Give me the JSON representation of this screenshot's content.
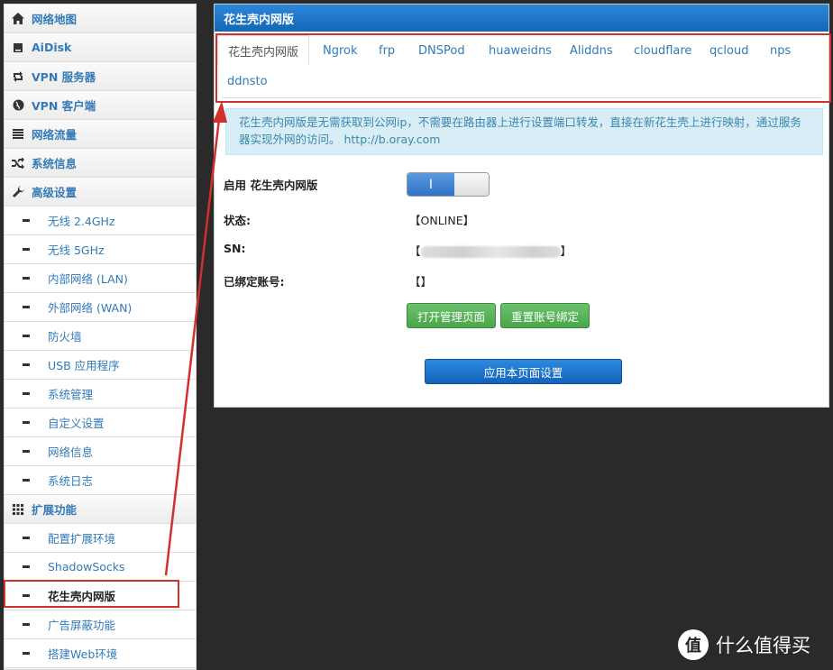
{
  "sidebar": {
    "items": [
      {
        "label": "网络地图",
        "icon": "home-icon"
      },
      {
        "label": "AiDisk",
        "icon": "disk-icon"
      },
      {
        "label": "VPN 服务器",
        "icon": "retweet-icon"
      },
      {
        "label": "VPN 客户端",
        "icon": "globe-icon"
      },
      {
        "label": "网络流量",
        "icon": "list-icon"
      },
      {
        "label": "系统信息",
        "icon": "random-icon"
      },
      {
        "label": "高级设置",
        "icon": "wrench-icon"
      }
    ],
    "advanced_sub": [
      "无线 2.4GHz",
      "无线 5GHz",
      "内部网络 (LAN)",
      "外部网络 (WAN)",
      "防火墙",
      "USB 应用程序",
      "系统管理",
      "自定义设置",
      "网络信息",
      "系统日志"
    ],
    "extensions": {
      "label": "扩展功能",
      "icon": "grid-icon"
    },
    "extension_sub": [
      "配置扩展环境",
      "ShadowSocks",
      "花生壳内网版",
      "广告屏蔽功能",
      "搭建Web环境"
    ]
  },
  "panel": {
    "title": "花生壳内网版",
    "tabs": [
      "花生壳内网版",
      "Ngrok",
      "frp",
      "DNSPod",
      "huaweidns",
      "Aliddns",
      "cloudflare",
      "qcloud",
      "nps",
      "ddnsto"
    ],
    "info_text": "花生壳内网版是无需获取到公网ip，不需要在路由器上进行设置端口转发，直接在新花生壳上进行映射，通过服务器实现外网的访问。 http://b.oray.com",
    "enable_label": "启用 花生壳内网版",
    "toggle_on_symbol": "I",
    "status_label": "状态:",
    "status_value": "【ONLINE】",
    "sn_label": "SN:",
    "sn_open": "【",
    "sn_close": "】",
    "account_label": "已绑定账号:",
    "account_value": "【】",
    "btn_open_admin": "打开管理页面",
    "btn_reset_bind": "重置账号绑定",
    "btn_apply": "应用本页面设置"
  },
  "watermark": {
    "logo": "值",
    "text": "什么值得买"
  },
  "colors": {
    "highlight": "#d0312d",
    "link": "#337ab7",
    "header": "#1f78d1",
    "success": "#5cb85c"
  }
}
